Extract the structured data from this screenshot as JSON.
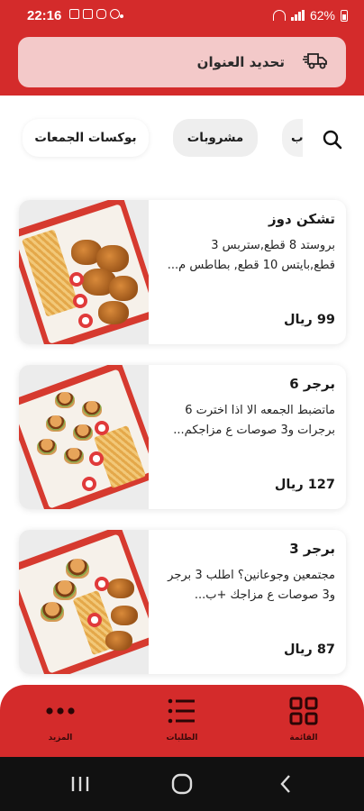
{
  "status_bar": {
    "time": "22:16",
    "battery": "62%"
  },
  "header": {
    "address_label": "تحديد العنوان",
    "address_icon": "delivery-truck-icon"
  },
  "categories": {
    "items": [
      {
        "label": "بوكسات الجمعات",
        "selected": true
      },
      {
        "label": "مشروبات",
        "selected": false
      },
      {
        "label": "ب",
        "selected": false
      }
    ],
    "search_icon": "search-icon"
  },
  "products": [
    {
      "title": "تشكن دوز",
      "description": "بروستد 8 قطع,ستربس 3 قطع,بايتس 10 قطع, بطاطس م...",
      "price": "99 ريال",
      "image": "fried-chicken-box"
    },
    {
      "title": "برجر 6",
      "description": "ماتضبط الجمعه الا اذا اخترت 6 برجرات و3 صوصات ع مزاجكم...",
      "price": "127 ريال",
      "image": "burger-box-6"
    },
    {
      "title": "برجر 3",
      "description": "مجتمعين وجوعانين؟ اطلب 3 برجر و3 صوصات ع مزاجك +ب...",
      "price": "87 ريال",
      "image": "burger-box-3"
    }
  ],
  "bottom_nav": {
    "items": [
      {
        "label": "القائمة",
        "icon": "grid-menu-icon"
      },
      {
        "label": "الطلبات",
        "icon": "list-icon"
      },
      {
        "label": "المزيد",
        "icon": "more-dots-icon"
      }
    ]
  },
  "colors": {
    "brand_red": "#d42b2b",
    "address_bar": "#f3c9c9"
  }
}
